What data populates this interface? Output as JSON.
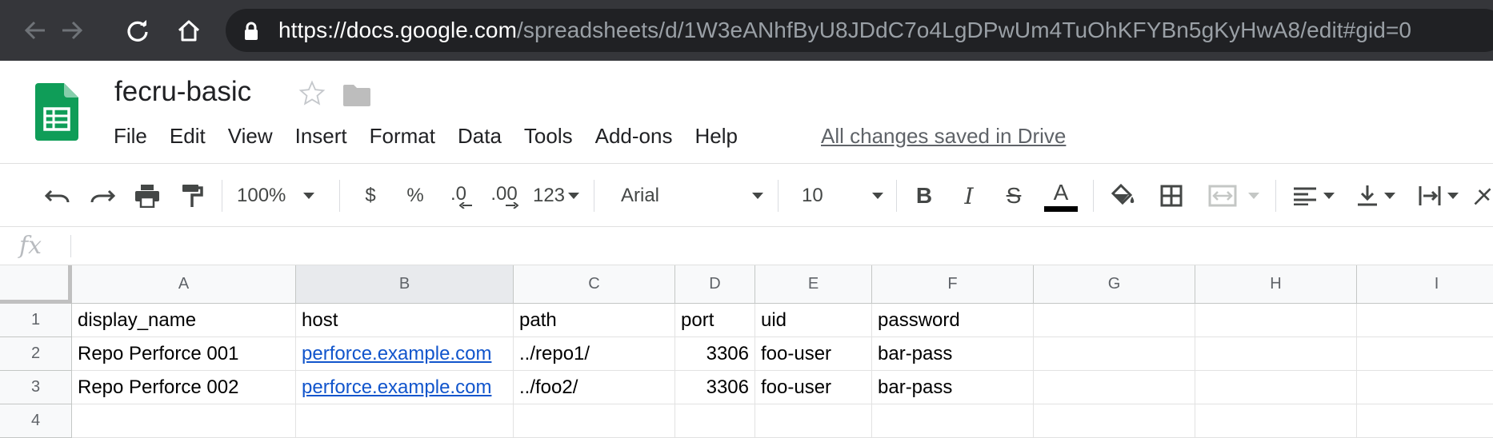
{
  "browser": {
    "url_host": "https://docs.google.com",
    "url_path": "/spreadsheets/d/1W3eANhfByU8JDdC7o4LgDPwUm4TuOhKFYBn5gKyHwA8/edit#gid=0"
  },
  "doc": {
    "title": "fecru-basic",
    "menu": [
      "File",
      "Edit",
      "View",
      "Insert",
      "Format",
      "Data",
      "Tools",
      "Add-ons",
      "Help"
    ],
    "save_status": "All changes saved in Drive"
  },
  "toolbar": {
    "zoom": "100%",
    "currency": "$",
    "percent": "%",
    "decrease_decimal": ".0",
    "increase_decimal": ".00",
    "more_formats": "123",
    "font": "Arial",
    "font_size": "10",
    "bold": "B",
    "italic": "I",
    "strike": "S",
    "text_color": "A"
  },
  "formula_bar": {
    "fx_label": "fx",
    "value": ""
  },
  "grid": {
    "columns": [
      "A",
      "B",
      "C",
      "D",
      "E",
      "F",
      "G",
      "H",
      "I"
    ],
    "rows": [
      "1",
      "2",
      "3",
      "4"
    ],
    "cells": [
      [
        "display_name",
        "host",
        "path",
        "port",
        "uid",
        "password",
        "",
        "",
        ""
      ],
      [
        "Repo Perforce 001",
        "perforce.example.com",
        "../repo1/",
        "3306",
        "foo-user",
        "bar-pass",
        "",
        "",
        ""
      ],
      [
        "Repo Perforce 002",
        "perforce.example.com",
        "../foo2/",
        "3306",
        "foo-user",
        "bar-pass",
        "",
        "",
        ""
      ],
      [
        "",
        "",
        "",
        "",
        "",
        "",
        "",
        "",
        ""
      ]
    ]
  },
  "colors": {
    "browser_bg": "#35363a",
    "omnibox_bg": "#202124",
    "link": "#1155cc",
    "sheets_green": "#0f9d58"
  }
}
